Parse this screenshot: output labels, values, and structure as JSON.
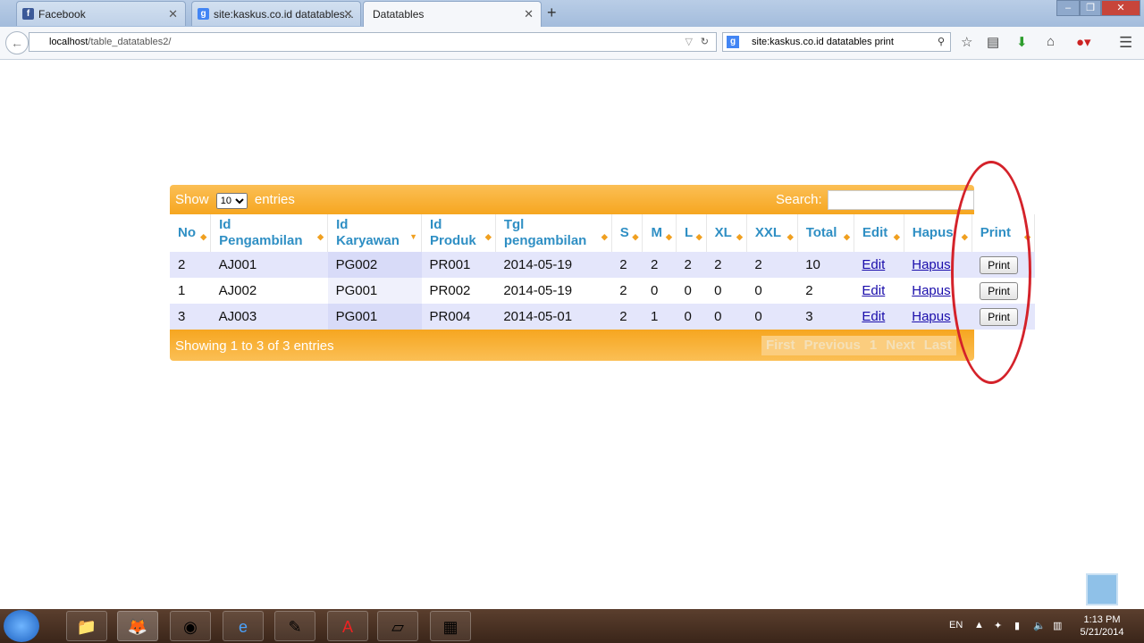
{
  "browser": {
    "tabs": [
      {
        "label": "Facebook",
        "icon": "facebook-icon",
        "color": "#3b5998"
      },
      {
        "label": "site:kaskus.co.id datatables...",
        "icon": "google-icon",
        "color": "#4285f4"
      },
      {
        "label": "Datatables",
        "icon": "",
        "color": ""
      }
    ],
    "url_host": "localhost",
    "url_path": "/table_datatables2/",
    "search_text": "site:kaskus.co.id datatables print"
  },
  "datatable": {
    "show_label": "Show",
    "entries_label": "entries",
    "length_value": "10",
    "search_label": "Search:",
    "columns": [
      [
        "No"
      ],
      [
        "Id",
        "Pengambilan"
      ],
      [
        "Id",
        "Karyawan"
      ],
      [
        "Id",
        "Produk"
      ],
      [
        "Tgl",
        "pengambilan"
      ],
      [
        "S"
      ],
      [
        "M"
      ],
      [
        "L"
      ],
      [
        "XL"
      ],
      [
        "XXL"
      ],
      [
        "Total"
      ],
      [
        "Edit"
      ],
      [
        "Hapus"
      ],
      [
        "Print"
      ]
    ],
    "rows": [
      [
        "2",
        "AJ001",
        "PG002",
        "PR001",
        "2014-05-19",
        "2",
        "2",
        "2",
        "2",
        "2",
        "10",
        "Edit",
        "Hapus",
        "Print"
      ],
      [
        "1",
        "AJ002",
        "PG001",
        "PR002",
        "2014-05-19",
        "2",
        "0",
        "0",
        "0",
        "0",
        "2",
        "Edit",
        "Hapus",
        "Print"
      ],
      [
        "3",
        "AJ003",
        "PG001",
        "PR004",
        "2014-05-01",
        "2",
        "1",
        "0",
        "0",
        "0",
        "3",
        "Edit",
        "Hapus",
        "Print"
      ]
    ],
    "info": "Showing 1 to 3 of 3 entries",
    "pager": [
      "First",
      "Previous",
      "1",
      "Next",
      "Last"
    ]
  },
  "taskbar": {
    "lang": "EN",
    "time": "1:13 PM",
    "date": "5/21/2014"
  }
}
